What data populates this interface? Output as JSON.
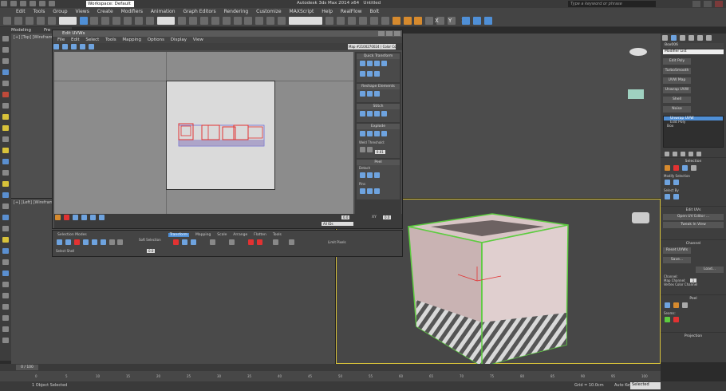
{
  "titlebar": {
    "workspace": "Workspace: Default",
    "app_title": "Autodesk 3ds Max 2014 x64",
    "file_name": "Untitled",
    "search_placeholder": "Type a keyword or phrase"
  },
  "menubar": {
    "items": [
      "Edit",
      "Tools",
      "Group",
      "Views",
      "Create",
      "Modifiers",
      "Animation",
      "Graph Editors",
      "Rendering",
      "Customize",
      "MAXScript",
      "Help",
      "RealFlow",
      "Bolt"
    ]
  },
  "toolbar": {
    "selection_filter": "All",
    "ref_coord": "View",
    "axis_constraints": "X Y Z"
  },
  "ribbon": {
    "tabs": [
      "Modeling",
      "Fre"
    ]
  },
  "viewports": {
    "top_left_label": "[+] [Top] [Wireframe]",
    "left_label": "[+] [Left] [Wireframe]"
  },
  "uvw_editor": {
    "title": "Edit UVWs",
    "menu": [
      "File",
      "Edit",
      "Select",
      "Tools",
      "Mapping",
      "Options",
      "Display",
      "View"
    ],
    "map_dropdown": "Map #2100270024 ( Color Co",
    "panels": {
      "quick_transform": "Quick Transform",
      "reshape_elements": "Reshape Elements",
      "stitch": "Stitch",
      "explode": "Explode",
      "weld": "Weld",
      "threshold_label": "Threshold:",
      "threshold_value": "0.01",
      "peel": "Peel",
      "detach": "Detach",
      "pins": "Pins"
    },
    "bottom": {
      "u_value": "0.0",
      "v_value": "0.0",
      "mode": "All IDs",
      "xy_label": "XY"
    }
  },
  "unwrap_options": {
    "selection_modes": "Selection Modes",
    "select_shell": "Select Shell",
    "tabs": [
      "Transform",
      "Mapping",
      "Scale",
      "Arrange",
      "Flatten",
      "Tools"
    ],
    "soft_select_label": "Soft Selection",
    "falloff": "0.0",
    "limit": "Limit Pixels"
  },
  "command_panel": {
    "object_name": "Box006",
    "modifier_list": "Modifier List",
    "buttons": [
      "Edit Poly",
      "TurboSmooth",
      "UVW Map",
      "Unwrap UVW",
      "Shell",
      "Noise"
    ],
    "stack": [
      "Unwrap UVW",
      "Edit Poly",
      "Box"
    ],
    "selection_header": "Selection",
    "modify_selection": "Modify Selection",
    "select_by": "Select By",
    "edit_uvs_header": "Edit UVs",
    "open_uv_editor": "Open UV Editor ...",
    "tweak_in_view": "Tweak In View",
    "channel_header": "Channel",
    "reset_uvws": "Reset UVWs",
    "save": "Save...",
    "load": "Load...",
    "channel_label": "Channel:",
    "map_channel": "Map Channel:",
    "map_channel_value": "1",
    "vertex_color_channel": "Vertex Color Channel",
    "peel_header": "Peel",
    "seams": "Seams:",
    "projection_header": "Projection"
  },
  "timeline": {
    "frame": "0 / 100",
    "ticks": [
      "0",
      "5",
      "10",
      "15",
      "20",
      "25",
      "30",
      "35",
      "40",
      "45",
      "50",
      "55",
      "60",
      "65",
      "70",
      "75",
      "80",
      "85",
      "90",
      "95",
      "100"
    ]
  },
  "status": {
    "selection": "1 Object Selected",
    "grid": "Grid = 10.0cm",
    "auto_key": "Auto Key",
    "set_key_mode": "Selected"
  },
  "colors": {
    "accent": "#4f8fd6",
    "uv_selected": "#e23232",
    "uv_edges": "#6a6ad8",
    "box_outline": "#5ccc3f"
  }
}
